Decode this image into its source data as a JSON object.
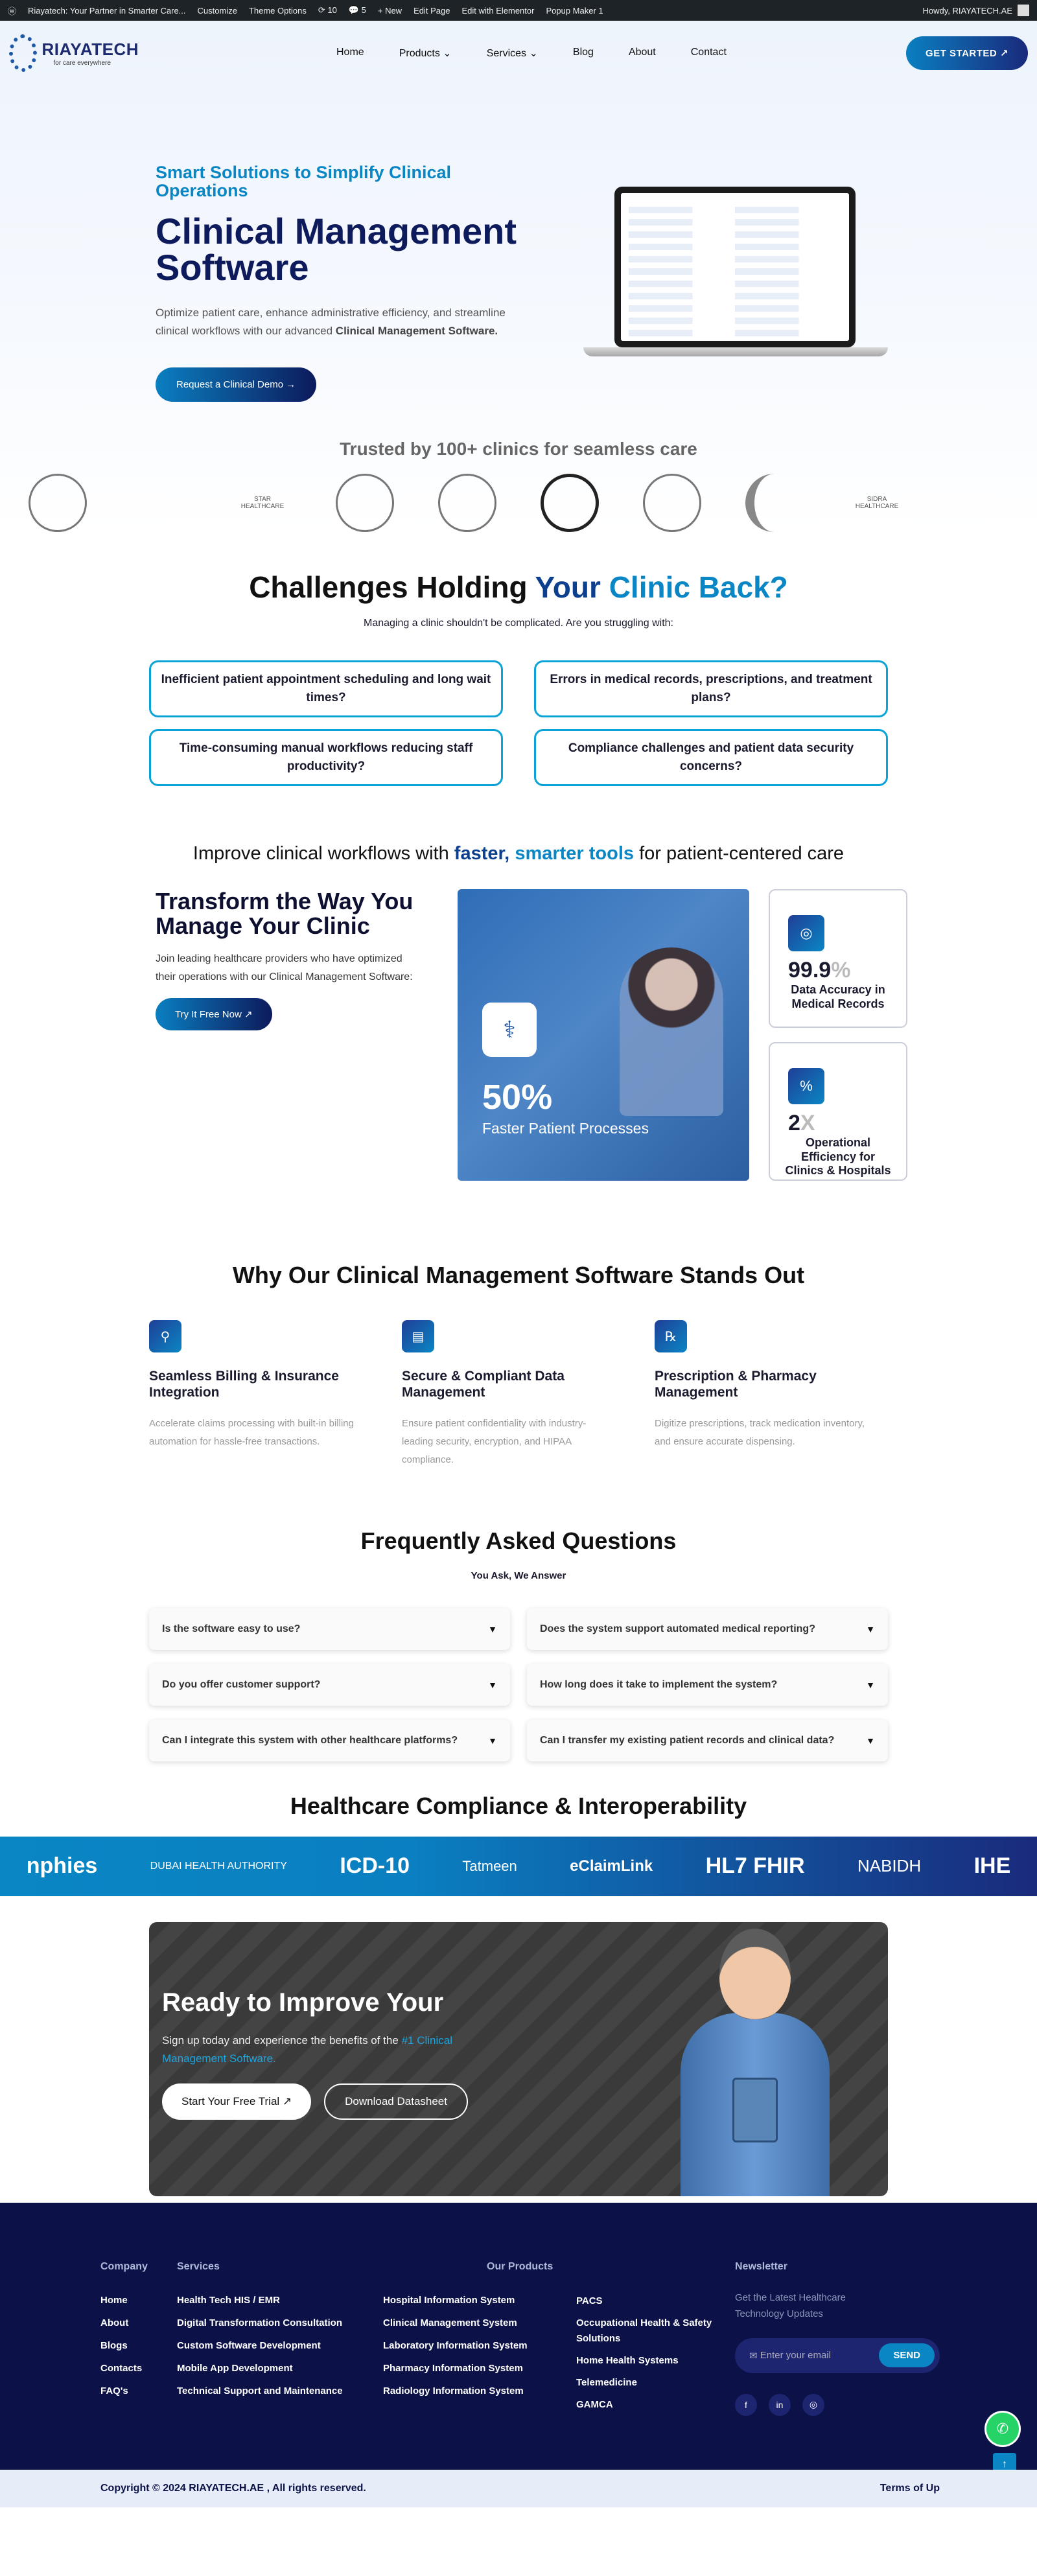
{
  "wpbar": {
    "site": "Riayatech: Your Partner in Smarter Care...",
    "customize": "Customize",
    "theme_options": "Theme Options",
    "updates": "10",
    "comments": "5",
    "new": "+ New",
    "edit_page": "Edit Page",
    "edit_elementor": "Edit with Elementor",
    "popup": "Popup Maker",
    "popup_count": "1",
    "howdy": "Howdy, RIAYATECH.AE"
  },
  "header": {
    "logo_name": "RIAYATECH",
    "logo_tag": "for care everywhere",
    "nav": [
      "Home",
      "Products",
      "Services",
      "Blog",
      "About",
      "Contact"
    ],
    "cta": "GET STARTED ↗"
  },
  "hero": {
    "kicker": "Smart Solutions to Simplify Clinical Operations",
    "title": "Clinical Management Software",
    "desc": "Optimize patient care, enhance administrative efficiency, and streamline clinical workflows with our advanced",
    "desc_bold": "Clinical Management Software.",
    "button": "Request a Clinical Demo →"
  },
  "trusted": "Trusted by 100+ clinics for seamless care",
  "clients": [
    "",
    "",
    "STAR HEALTHCARE",
    "",
    "",
    "",
    "",
    "",
    "SIDRA HEALTHCARE",
    ""
  ],
  "challenges": {
    "title_a": "Challenges Holding",
    "title_b": "Your",
    "title_c": "Clinic Back?",
    "sub": "Managing a clinic shouldn't be complicated. Are you struggling with:",
    "items": [
      "Inefficient patient appointment scheduling and long wait times?",
      "Errors in medical records, prescriptions, and treatment plans?",
      "Time-consuming manual workflows reducing staff productivity?",
      "Compliance challenges and patient data security concerns?"
    ]
  },
  "improve": {
    "pre": "Improve clinical workflows with",
    "b1": "faster,",
    "b2": "smarter tools",
    "post": "for patient-centered care"
  },
  "transform": {
    "title": "Transform the Way You Manage Your Clinic",
    "desc": "Join leading healthcare providers who have optimized their operations with our Clinical Management Software:",
    "button": "Try It Free Now ↗",
    "pct": "50%",
    "pct_label": "Faster Patient Processes"
  },
  "stats": [
    {
      "v": "99.9",
      "u": "%",
      "l": "Data Accuracy in Medical Records"
    },
    {
      "v": "2",
      "u": "X",
      "l": "Operational Efficiency for Clinics & Hospitals"
    }
  ],
  "why": {
    "title": "Why Our Clinical Management Software Stands Out",
    "items": [
      {
        "t": "Seamless Billing & Insurance Integration",
        "d": "Accelerate claims processing with built-in billing automation for hassle-free transactions."
      },
      {
        "t": "Secure & Compliant Data Management",
        "d": "Ensure patient confidentiality with industry-leading security, encryption, and HIPAA compliance."
      },
      {
        "t": "Prescription & Pharmacy Management",
        "d": "Digitize prescriptions, track medication inventory, and ensure accurate dispensing."
      }
    ]
  },
  "faq": {
    "title": "Frequently Asked Questions",
    "sub": "You Ask, We Answer",
    "items": [
      "Is the software easy to use?",
      "Does the system support automated medical reporting?",
      "Do you offer customer support?",
      "How long does it take to implement the system?",
      "Can I integrate this system with other healthcare platforms?",
      "Can I transfer my existing patient records and clinical data?"
    ]
  },
  "compliance": {
    "title": "Healthcare Compliance & Interoperability",
    "logos": [
      "nphies",
      "DUBAI HEALTH AUTHORITY",
      "ICD-10",
      "Tatmeen",
      "eClaimLink",
      "HL7 FHIR",
      "NABIDH",
      "IHE"
    ]
  },
  "ready": {
    "title": "Ready to Improve Your",
    "desc": "Sign up today and experience the benefits of the",
    "hl": "#1 Clinical Management Software.",
    "b1": "Start Your Free Trial ↗",
    "b2": "Download Datasheet"
  },
  "footer": {
    "company_h": "Company",
    "company": [
      "Home",
      "About",
      "Blogs",
      "Contacts",
      "FAQ's"
    ],
    "services_h": "Services",
    "services": [
      "Health Tech HIS / EMR",
      "Digital Transformation Consultation",
      "Custom Software Development",
      "Mobile App Development",
      "Technical Support and Maintenance"
    ],
    "products_h": "Our Products",
    "products_a": [
      "Hospital Information System",
      "Clinical Management System",
      "Laboratory Information System",
      "Pharmacy Information System",
      "Radiology Information System"
    ],
    "products_b": [
      "PACS",
      "Occupational Health & Safety Solutions",
      "Home Health Systems",
      "Telemedicine",
      "GAMCA"
    ],
    "news_h": "Newsletter",
    "news_d": "Get the Latest Healthcare Technology Updates",
    "email_ph": "Enter your email",
    "send": "SEND",
    "copyright": "Copyright © 2024 RIAYATECH.AE , All rights reserved.",
    "terms": "Terms of Up"
  }
}
